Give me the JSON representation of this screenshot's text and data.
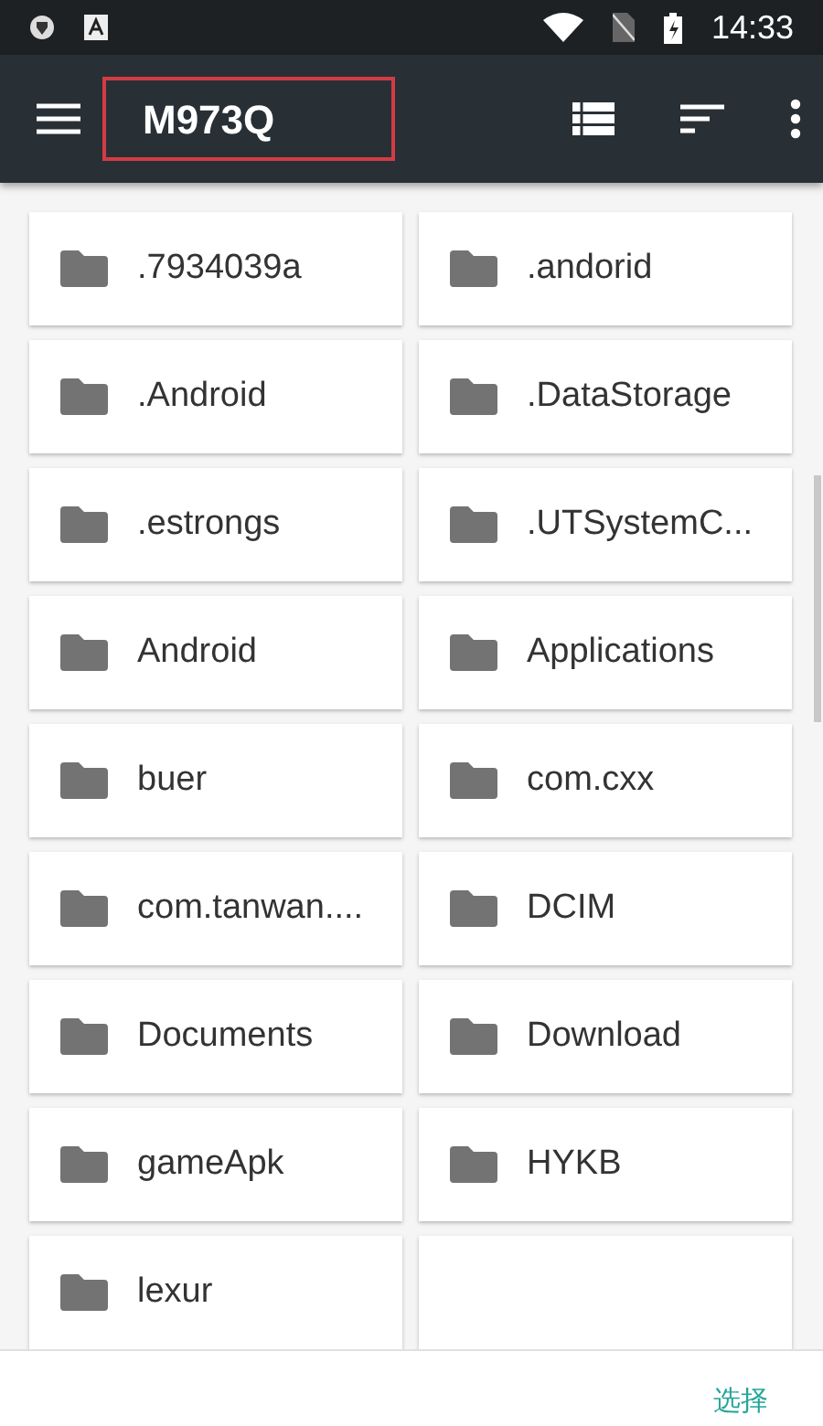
{
  "status_bar": {
    "time": "14:33"
  },
  "toolbar": {
    "title": "M973Q",
    "title_highlighted": true
  },
  "folders": [
    {
      "name": ".7934039a"
    },
    {
      "name": ".andorid"
    },
    {
      "name": ".Android"
    },
    {
      "name": ".DataStorage"
    },
    {
      "name": ".estrongs"
    },
    {
      "name": ".UTSystemC..."
    },
    {
      "name": "Android"
    },
    {
      "name": "Applications"
    },
    {
      "name": "buer"
    },
    {
      "name": "com.cxx"
    },
    {
      "name": "com.tanwan...."
    },
    {
      "name": "DCIM"
    },
    {
      "name": "Documents"
    },
    {
      "name": "Download"
    },
    {
      "name": "gameApk"
    },
    {
      "name": "HYKB"
    },
    {
      "name": "lexur"
    }
  ],
  "bottom_bar": {
    "action": "选择"
  }
}
